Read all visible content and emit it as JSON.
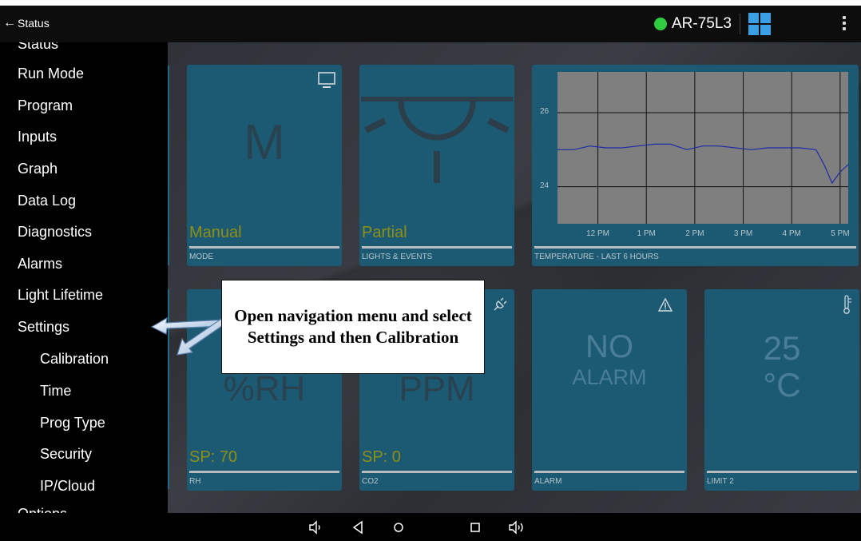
{
  "app": {
    "back_label": "Status",
    "device_name": "AR-75L3"
  },
  "drawer": {
    "partial_top": "Status",
    "items": [
      {
        "label": "Run Mode"
      },
      {
        "label": "Program"
      },
      {
        "label": "Inputs"
      },
      {
        "label": "Graph"
      },
      {
        "label": "Data Log"
      },
      {
        "label": "Diagnostics"
      },
      {
        "label": "Alarms"
      },
      {
        "label": "Light Lifetime"
      },
      {
        "label": "Settings"
      }
    ],
    "sub_items": [
      {
        "label": "Calibration"
      },
      {
        "label": "Time"
      },
      {
        "label": "Prog Type"
      },
      {
        "label": "Security"
      },
      {
        "label": "IP/Cloud"
      }
    ],
    "partial_bottom": "Options"
  },
  "tiles": {
    "mode": {
      "big": "M",
      "status": "Manual",
      "label": "MODE",
      "icon": "monitor-icon"
    },
    "lights": {
      "status": "Partial",
      "label": "LIGHTS & EVENTS",
      "icon": "lamp-icon"
    },
    "temperature": {
      "label": "TEMPERATURE - LAST 6 HOURS"
    },
    "rh": {
      "big": "%RH",
      "status": "SP: 70",
      "label": "RH"
    },
    "co2": {
      "big": "PPM",
      "status": "SP: 0",
      "label": "CO2",
      "icon": "plug-icon"
    },
    "alarm": {
      "big_line1": "NO",
      "big_line2": "ALARM",
      "label": "ALARM",
      "icon": "warning-icon"
    },
    "limit2": {
      "big_line1": "25",
      "big_line2": "°C",
      "label": "LIMIT 2",
      "icon": "thermometer-icon"
    }
  },
  "chart_data": {
    "type": "line",
    "title": "TEMPERATURE - LAST 6 HOURS",
    "x": [
      "11:10 AM",
      "11:30 AM",
      "11:50 AM",
      "12:10 PM",
      "12:30 PM",
      "12:50 PM",
      "1:10 PM",
      "1:30 PM",
      "1:50 PM",
      "2:10 PM",
      "2:30 PM",
      "2:50 PM",
      "3:10 PM",
      "3:30 PM",
      "3:50 PM",
      "4:10 PM",
      "4:30 PM",
      "4:40 PM",
      "4:50 PM",
      "5:00 PM",
      "5:10 PM"
    ],
    "xticks": [
      "12 PM",
      "1 PM",
      "2 PM",
      "3 PM",
      "4 PM",
      "5 PM"
    ],
    "yticks": [
      24,
      26
    ],
    "ylim": [
      23.0,
      27.1
    ],
    "series": [
      {
        "values": [
          25.0,
          25.0,
          25.1,
          25.05,
          25.05,
          25.1,
          25.15,
          25.15,
          25.0,
          25.1,
          25.1,
          25.05,
          25.0,
          25.05,
          25.05,
          25.05,
          25.0,
          24.6,
          24.1,
          24.4,
          24.6
        ]
      }
    ],
    "line_color": "#1f2aa8",
    "grid": true
  },
  "callout": {
    "text": "Open navigation menu and select Settings and then Calibration"
  },
  "navbar": {
    "icons": [
      "volume-down-icon",
      "back-icon",
      "home-icon",
      "recents-icon",
      "volume-up-icon"
    ]
  }
}
